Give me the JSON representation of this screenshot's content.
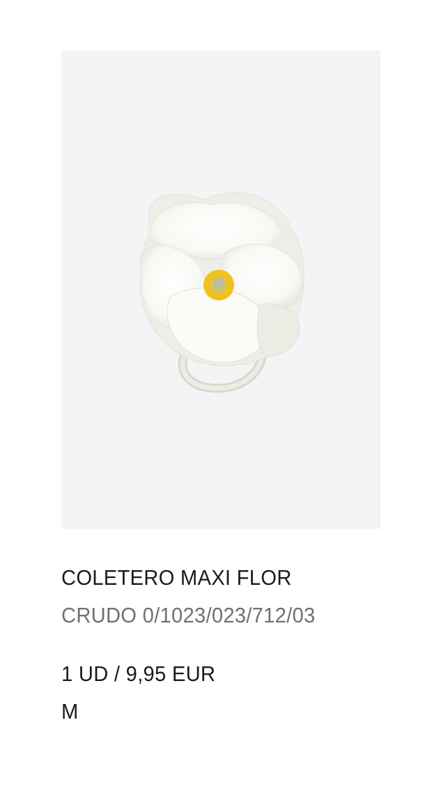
{
  "product": {
    "name": "COLETERO MAXI FLOR",
    "reference": "CRUDO 0/1023/023/712/03",
    "price": "1 UD / 9,95 EUR",
    "size": "M",
    "image": {
      "background": "#f4f4f6",
      "subject": "flower-scrunchie"
    }
  }
}
